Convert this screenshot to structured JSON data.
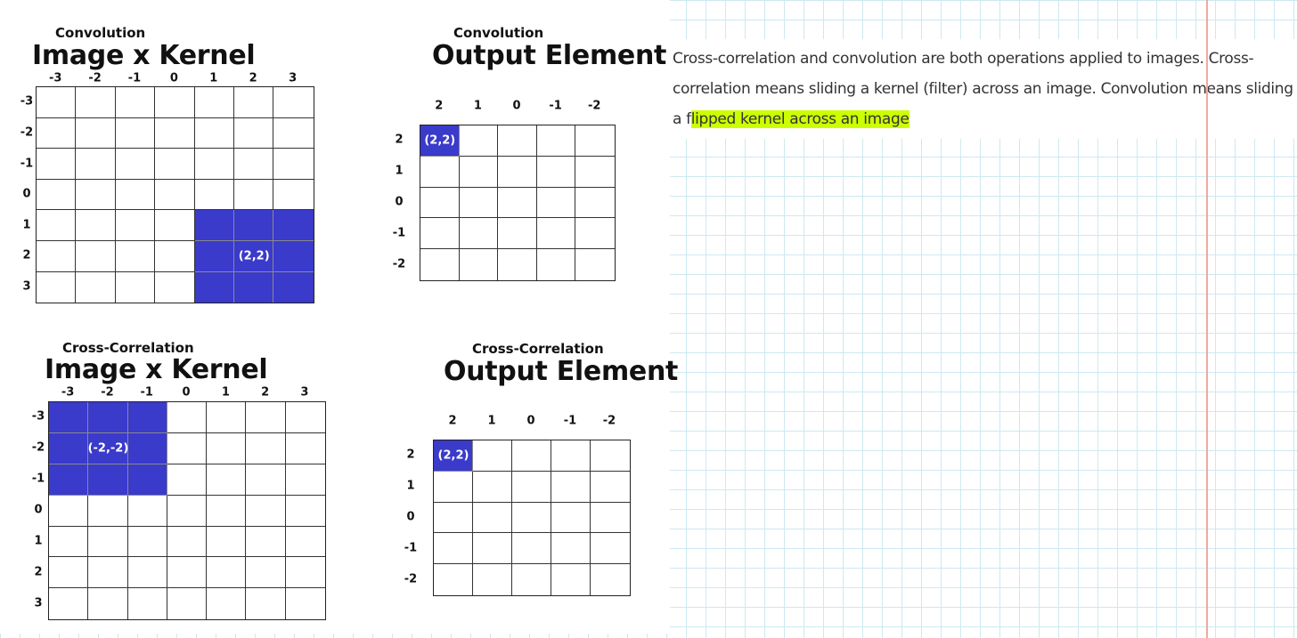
{
  "panels": [
    {
      "caption": "Convolution",
      "title": "Image x Kernel",
      "col_labels": [
        "-3",
        "-2",
        "-1",
        "0",
        "1",
        "2",
        "3"
      ],
      "row_labels": [
        "-3",
        "-2",
        "-1",
        "0",
        "1",
        "2",
        "3"
      ],
      "rows": 7,
      "cols": 7,
      "highlight": {
        "row_start": 4,
        "row_end": 6,
        "col_start": 4,
        "col_end": 6
      },
      "cell_label": "(2,2)",
      "highlight_color": "#3a3acb"
    },
    {
      "caption": "Convolution",
      "title": "Output Element",
      "col_labels": [
        "2",
        "1",
        "0",
        "-1",
        "-2"
      ],
      "row_labels": [
        "2",
        "1",
        "0",
        "-1",
        "-2"
      ],
      "rows": 5,
      "cols": 5,
      "highlight": {
        "row_start": 0,
        "row_end": 0,
        "col_start": 0,
        "col_end": 0
      },
      "cell_label": "(2,2)",
      "highlight_color": "#3a3acb"
    },
    {
      "caption": "Cross-Correlation",
      "title": "Image x Kernel",
      "col_labels": [
        "-3",
        "-2",
        "-1",
        "0",
        "1",
        "2",
        "3"
      ],
      "row_labels": [
        "-3",
        "-2",
        "-1",
        "0",
        "1",
        "2",
        "3"
      ],
      "rows": 7,
      "cols": 7,
      "highlight": {
        "row_start": 0,
        "row_end": 2,
        "col_start": 0,
        "col_end": 2
      },
      "cell_label": "(-2,-2)",
      "highlight_color": "#3a3acb"
    },
    {
      "caption": "Cross-Correlation",
      "title": "Output Element",
      "col_labels": [
        "2",
        "1",
        "0",
        "-1",
        "-2"
      ],
      "row_labels": [
        "2",
        "1",
        "0",
        "-1",
        "-2"
      ],
      "rows": 5,
      "cols": 5,
      "highlight": {
        "row_start": 0,
        "row_end": 0,
        "col_start": 0,
        "col_end": 0
      },
      "cell_label": "(2,2)",
      "highlight_color": "#3a3acb"
    }
  ],
  "note": {
    "before": "Cross-correlation and convolution are both operations applied to images. Cross-correlation means sliding a kernel (filter) across an image. Convolution means sliding a f",
    "highlighted": "lipped kernel across an image",
    "highlight_color": "#ccff00"
  }
}
